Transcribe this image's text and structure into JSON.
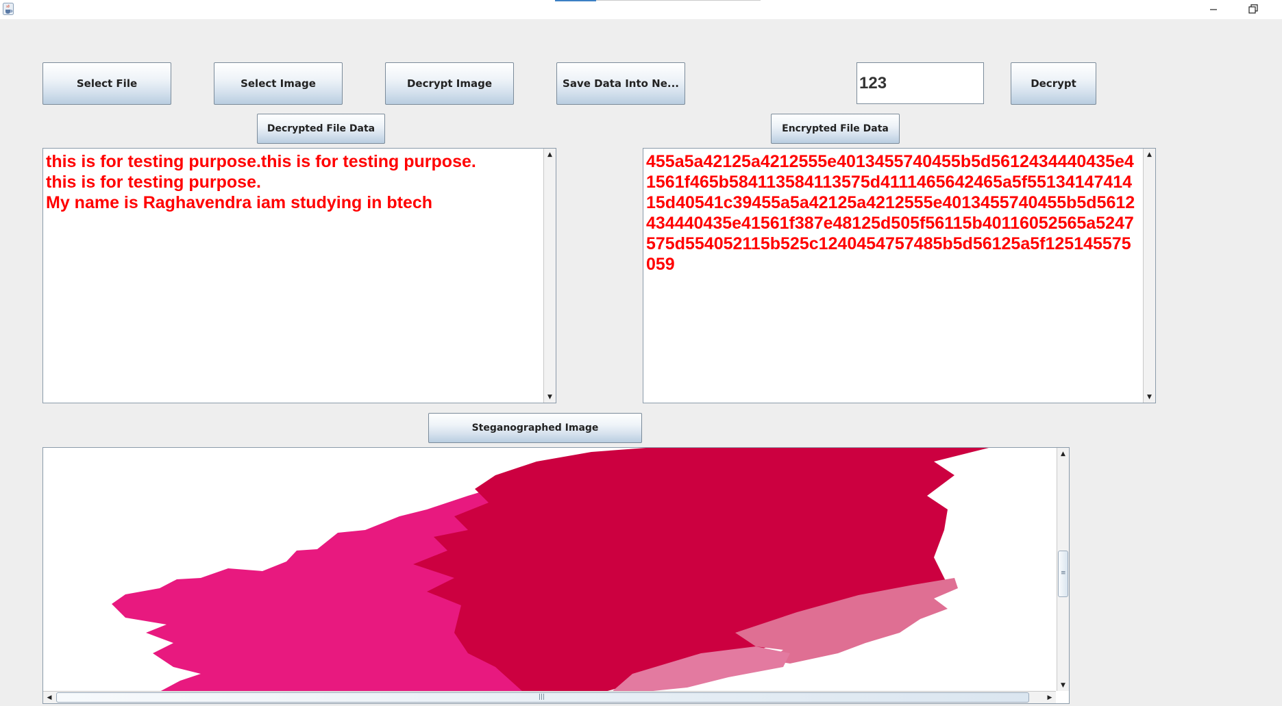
{
  "window": {
    "app_icon": "java-cup-icon",
    "minimize_icon": "minimize-icon",
    "restore_icon": "restore-icon"
  },
  "toolbar": {
    "select_file": "Select File",
    "select_image": "Select Image",
    "decrypt_image": "Decrypt Image",
    "save_data": "Save Data Into Ne...",
    "key_value": "123",
    "decrypt": "Decrypt"
  },
  "panels": {
    "decrypted_label": "Decrypted File Data",
    "encrypted_label": "Encrypted File Data",
    "decrypted_text": "this is for testing purpose.this is for testing purpose.\nthis is for testing purpose.\nMy name is Raghavendra iam studying in btech",
    "encrypted_text": "455a5a42125a4212555e4013455740455b5d5612434440435e41561f465b584113584113575d4111465642465a5f5513414741415d40541c39455a5a42125a4212555e4013455740455b5d5612434440435e41561f387e48125d505f56115b40116052565a5247575d554052115b525c1240454757485b5d56125a5f125145575059"
  },
  "image_section": {
    "label": "Steganographed Image",
    "image_desc": "pink-paint-brush-stroke-image"
  },
  "colors": {
    "text_red": "#ff0000",
    "paint_pink": "#e8197f",
    "paint_crimson": "#cc0040",
    "paint_light": "#df6f93",
    "background": "#eeeeee"
  }
}
